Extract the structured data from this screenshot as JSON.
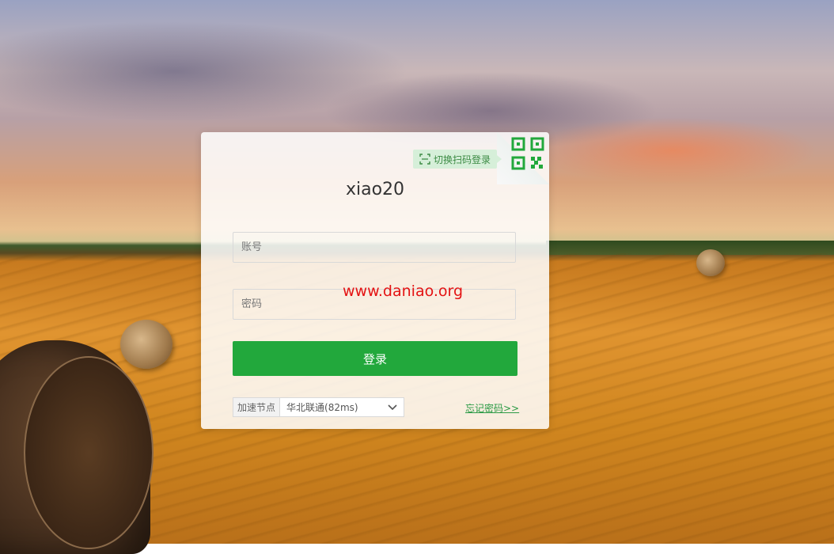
{
  "login": {
    "scan_tip": "切换扫码登录",
    "title": "xiao20",
    "account_placeholder": "账号",
    "password_placeholder": "密码",
    "watermark": "www.daniao.org",
    "login_button": "登录",
    "node_label": "加速节点",
    "node_selected": "华北联通(82ms)",
    "forgot_link": "忘记密码>>"
  },
  "colors": {
    "accent": "#22a83c",
    "watermark": "#e41212",
    "tip_bg": "#d6efd9"
  },
  "icons": {
    "qr": "qr-code-icon",
    "scan": "scan-icon",
    "chevron": "chevron-down-icon"
  }
}
